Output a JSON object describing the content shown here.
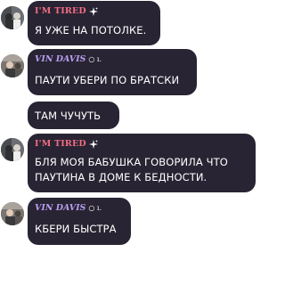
{
  "chat": {
    "messages": [
      {
        "author": "I'M TIRED",
        "text": "Я УЖЕ НА ПОТОЛКЕ."
      },
      {
        "author": "VIN DAVIS",
        "author_suffix": "○ ı.",
        "text": "ПАУТИ УБЕРИ ПО БРАТСКИ"
      },
      {
        "text": "ТАМ ЧУЧУТЬ"
      },
      {
        "author": "I'M TIRED",
        "text_line1": "БЛЯ МОЯ БАБУШКА ГОВОРИЛА ЧТО",
        "text_line2": "ПАУТИНА В ДОМЕ К БЕДНОСТИ."
      },
      {
        "author": "VIN DAVIS",
        "author_suffix": "○ ı.",
        "text": "КБЕРИ БЫСТРА"
      }
    ]
  },
  "colors": {
    "bubble_bg": "#292433",
    "tired_name": "#f26e84",
    "vin_name": "#b79ff0",
    "message_text": "#ffffff"
  },
  "icons": [
    "sparkle-icon"
  ]
}
